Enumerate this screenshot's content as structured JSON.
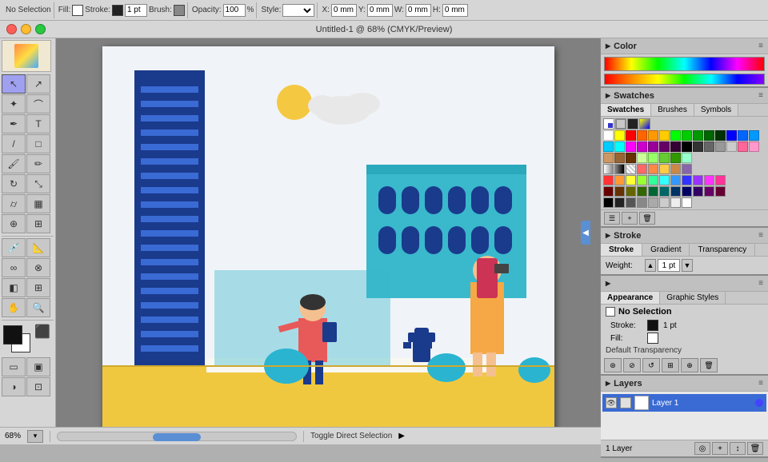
{
  "app": {
    "title": "Untitled-1 @ 68% (CMYK/Preview)",
    "zoom": "68%"
  },
  "toolbar": {
    "no_selection": "No Selection",
    "fill_label": "Fill:",
    "stroke_label": "Stroke:",
    "brush_label": "Brush:",
    "opacity_label": "Opacity:",
    "opacity_val": "100",
    "style_label": "Style:",
    "x_label": "X:",
    "x_val": "0 mm",
    "y_label": "Y:",
    "y_val": "0 mm",
    "w_label": "W:",
    "w_val": "0 mm",
    "h_label": "H:",
    "h_val": "0 mm",
    "stroke_val": "1 pt"
  },
  "panels": {
    "color": {
      "title": "Color"
    },
    "swatches": {
      "tabs": [
        "Swatches",
        "Brushes",
        "Symbols"
      ]
    },
    "stroke": {
      "title": "Stroke",
      "tabs": [
        "Stroke",
        "Gradient",
        "Transparency"
      ],
      "weight_label": "Weight:",
      "weight_val": "1 pt"
    },
    "appearance": {
      "title": "Appearance",
      "tabs": [
        "Appearance",
        "Graphic Styles"
      ],
      "no_selection": "No Selection",
      "stroke_label": "Stroke:",
      "stroke_val": "1 pt",
      "fill_label": "Fill:",
      "default_transparency": "Default Transparency"
    },
    "layers": {
      "title": "Layers",
      "layer_name": "Layer 1",
      "layers_count": "1 Layer",
      "toggle_label": "Toggle Direct Selection"
    }
  },
  "status": {
    "zoom": "68%",
    "toggle_direct": "Toggle Direct Selection"
  },
  "colors": {
    "stroke_box": "#1a1a1a",
    "fill_box": "#ffffff",
    "accent": "#3a6ad4",
    "tower": "#1a3a8c",
    "sun": "#f5c842",
    "sky": "#e8f0f8",
    "teal": "#2ab4d0",
    "orange_person": "#f5a845",
    "pink_person": "#e85a5a",
    "ground": "#f0c840"
  },
  "swatches_colors": [
    "#ffffff",
    "#ffff00",
    "#ff0000",
    "#ff6600",
    "#ff9900",
    "#ffcc00",
    "#00ff00",
    "#00cc00",
    "#009900",
    "#006600",
    "#003300",
    "#0000ff",
    "#0066ff",
    "#0099ff",
    "#00ccff",
    "#00ffff",
    "#ff00ff",
    "#cc00cc",
    "#990099",
    "#660066",
    "#330033",
    "#000000",
    "#333333",
    "#666666",
    "#999999",
    "#cccccc",
    "#ff6699",
    "#ff99cc",
    "#cc9966",
    "#996633",
    "#663300",
    "#ccff99",
    "#99ff66",
    "#66cc33",
    "#339900",
    "#99ffcc"
  ]
}
